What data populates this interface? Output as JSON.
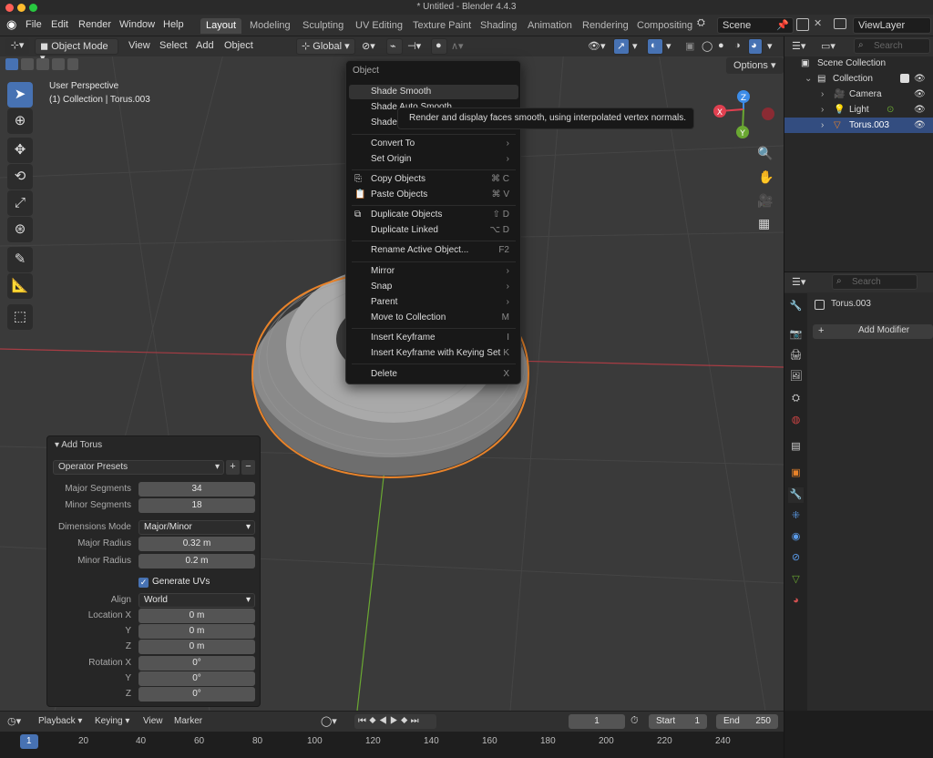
{
  "window": {
    "title": "* Untitled - Blender 4.4.3",
    "traffic_colors": [
      "#ff5f57",
      "#febc2e",
      "#28c840"
    ]
  },
  "menubar": {
    "items": [
      "File",
      "Edit",
      "Render",
      "Window",
      "Help"
    ],
    "workspaces": [
      "Layout",
      "Modeling",
      "Sculpting",
      "UV Editing",
      "Texture Paint",
      "Shading",
      "Animation",
      "Rendering",
      "Compositing"
    ],
    "active_workspace": "Layout",
    "scene": "Scene",
    "view_layer": "ViewLayer"
  },
  "viewport": {
    "mode": "Object Mode",
    "menus": [
      "View",
      "Select",
      "Add",
      "Object"
    ],
    "transform_orientation": "Global",
    "options_label": "Options",
    "overlay_line1": "User Perspective",
    "overlay_line2": "(1) Collection | Torus.003",
    "gizmo_axes": {
      "z": "Z",
      "x": "X",
      "y": "Y"
    },
    "colors": {
      "accent": "#4772b3",
      "selection_outline": "#e8832a",
      "x_axis": "#e04050",
      "y_axis": "#6aa832",
      "z_axis": "#3c8ce8"
    }
  },
  "context_menu": {
    "title": "Object",
    "items": [
      {
        "label": "Shade Smooth",
        "shortcut": ""
      },
      {
        "label": "Shade Auto Smooth",
        "shortcut": ""
      },
      {
        "label": "Shade Flat",
        "shortcut": ""
      },
      {
        "label": "Convert To",
        "shortcut": "›"
      },
      {
        "label": "Set Origin",
        "shortcut": "›"
      },
      {
        "label": "Copy Objects",
        "shortcut": "⌘ C"
      },
      {
        "label": "Paste Objects",
        "shortcut": "⌘ V"
      },
      {
        "label": "Duplicate Objects",
        "shortcut": "⇧ D"
      },
      {
        "label": "Duplicate Linked",
        "shortcut": "⌥ D"
      },
      {
        "label": "Rename Active Object...",
        "shortcut": "F2"
      },
      {
        "label": "Mirror",
        "shortcut": "›"
      },
      {
        "label": "Snap",
        "shortcut": "›"
      },
      {
        "label": "Parent",
        "shortcut": "›"
      },
      {
        "label": "Move to Collection",
        "shortcut": "M"
      },
      {
        "label": "Insert Keyframe",
        "shortcut": "I"
      },
      {
        "label": "Insert Keyframe with Keying Set",
        "shortcut": "K"
      },
      {
        "label": "Delete",
        "shortcut": "X"
      }
    ],
    "tooltip": "Render and display faces smooth, using interpolated vertex normals."
  },
  "operator_panel": {
    "title": "Add Torus",
    "presets": "Operator Presets",
    "fields": {
      "major_segments": {
        "label": "Major Segments",
        "value": "34"
      },
      "minor_segments": {
        "label": "Minor Segments",
        "value": "18"
      },
      "dimensions_mode": {
        "label": "Dimensions Mode",
        "value": "Major/Minor"
      },
      "major_radius": {
        "label": "Major Radius",
        "value": "0.32 m"
      },
      "minor_radius": {
        "label": "Minor Radius",
        "value": "0.2 m"
      },
      "generate_uvs": {
        "label": "Generate UVs",
        "checked": true
      },
      "align": {
        "label": "Align",
        "value": "World"
      },
      "location_x": {
        "label": "Location X",
        "value": "0 m"
      },
      "location_y": {
        "label": "Y",
        "value": "0 m"
      },
      "location_z": {
        "label": "Z",
        "value": "0 m"
      },
      "rotation_x": {
        "label": "Rotation X",
        "value": "0°"
      },
      "rotation_y": {
        "label": "Y",
        "value": "0°"
      },
      "rotation_z": {
        "label": "Z",
        "value": "0°"
      }
    }
  },
  "outliner": {
    "search_placeholder": "Search",
    "rows": [
      "Scene Collection",
      "Collection",
      "Camera",
      "Light",
      "Torus.003"
    ]
  },
  "properties": {
    "search_placeholder": "Search",
    "object_name": "Torus.003",
    "add_modifier": "Add Modifier"
  },
  "timeline": {
    "menus": [
      "Playback",
      "Keying",
      "View",
      "Marker"
    ],
    "current_frame": "1",
    "start_label": "Start",
    "start": "1",
    "end_label": "End",
    "end": "250",
    "ruler": [
      "1",
      "20",
      "40",
      "60",
      "80",
      "100",
      "120",
      "140",
      "160",
      "180",
      "200",
      "220",
      "240"
    ]
  }
}
